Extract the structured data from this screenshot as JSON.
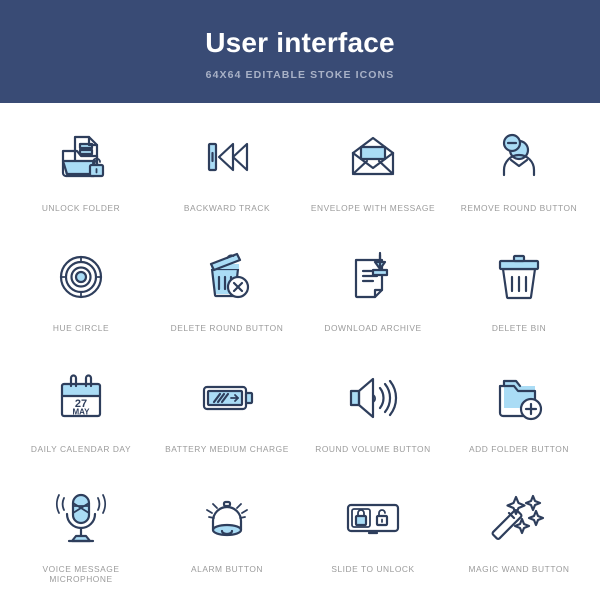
{
  "header": {
    "title": "User interface",
    "subtitle": "64X64 EDITABLE STOKE ICONS",
    "background_color": "#394b75",
    "title_color": "#ffffff",
    "subtitle_color": "#a9b2c7"
  },
  "theme": {
    "page_background": "#ffffff",
    "icon_stroke_color": "#2e3e5c",
    "icon_accent_fill": "#aadcf5",
    "label_color": "#9b9b9b"
  },
  "grid": {
    "columns": 4,
    "rows": 4,
    "items": [
      {
        "label": "unlock folder",
        "icon": "unlock-folder-icon"
      },
      {
        "label": "backward track",
        "icon": "backward-track-icon"
      },
      {
        "label": "envelope with message",
        "icon": "envelope-with-message-icon"
      },
      {
        "label": "remove round button",
        "icon": "remove-round-button-icon"
      },
      {
        "label": "hue circle",
        "icon": "hue-circle-icon"
      },
      {
        "label": "delete round button",
        "icon": "delete-round-button-icon"
      },
      {
        "label": "download archive",
        "icon": "download-archive-icon"
      },
      {
        "label": "delete bin",
        "icon": "delete-bin-icon"
      },
      {
        "label": "daily calendar day",
        "icon": "daily-calendar-day-icon"
      },
      {
        "label": "battery medium charge",
        "icon": "battery-medium-charge-icon"
      },
      {
        "label": "round volume button",
        "icon": "round-volume-button-icon"
      },
      {
        "label": "add folder button",
        "icon": "add-folder-button-icon"
      },
      {
        "label": "voice message microphone",
        "icon": "voice-message-microphone-icon"
      },
      {
        "label": "alarm button",
        "icon": "alarm-button-icon"
      },
      {
        "label": "slide to unlock",
        "icon": "slide-to-unlock-icon"
      },
      {
        "label": "magic wand button",
        "icon": "magic-wand-button-icon"
      }
    ]
  },
  "calendar_icon": {
    "day": "27",
    "month": "MAY"
  }
}
